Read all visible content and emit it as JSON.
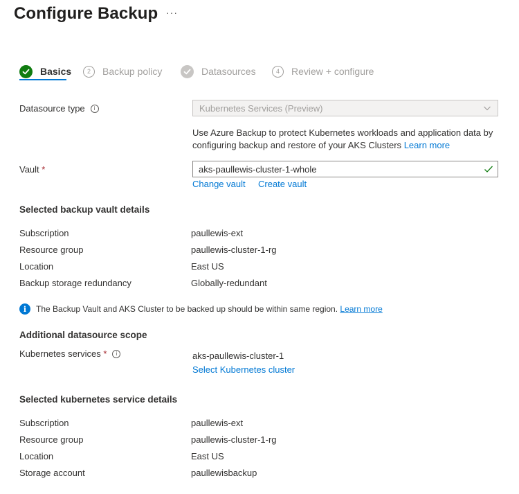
{
  "page": {
    "title": "Configure Backup",
    "more_label": "···"
  },
  "tabs": [
    {
      "label": "Basics",
      "step": "",
      "state": "active"
    },
    {
      "label": "Backup policy",
      "step": "2",
      "state": "pending"
    },
    {
      "label": "Datasources",
      "step": "",
      "state": "done"
    },
    {
      "label": "Review + configure",
      "step": "4",
      "state": "pending"
    }
  ],
  "datasource": {
    "label": "Datasource type",
    "value": "Kubernetes Services (Preview)",
    "description": "Use Azure Backup to protect Kubernetes workloads and application data by configuring backup and restore of your AKS Clusters",
    "learn_more": "Learn more"
  },
  "vault": {
    "label": "Vault",
    "required": "*",
    "value": "aks-paullewis-cluster-1-whole",
    "change_link": "Change vault",
    "create_link": "Create vault"
  },
  "vault_details": {
    "heading": "Selected backup vault details",
    "rows": [
      {
        "label": "Subscription",
        "value": "paullewis-ext"
      },
      {
        "label": "Resource group",
        "value": "paullewis-cluster-1-rg"
      },
      {
        "label": "Location",
        "value": "East US"
      },
      {
        "label": "Backup storage redundancy",
        "value": "Globally-redundant"
      }
    ]
  },
  "notice": {
    "text": "The Backup Vault and AKS Cluster to be backed up should be within same region.",
    "link": "Learn more"
  },
  "scope": {
    "heading": "Additional datasource scope",
    "label": "Kubernetes services",
    "required": "*",
    "value": "aks-paullewis-cluster-1",
    "select_link": "Select Kubernetes cluster"
  },
  "k8s_details": {
    "heading": "Selected kubernetes service details",
    "rows": [
      {
        "label": "Subscription",
        "value": "paullewis-ext"
      },
      {
        "label": "Resource group",
        "value": "paullewis-cluster-1-rg"
      },
      {
        "label": "Location",
        "value": "East US"
      },
      {
        "label": "Storage account",
        "value": "paullewisbackup"
      }
    ]
  },
  "colors": {
    "accent": "#0078d4",
    "success": "#107c10",
    "required": "#a4262c"
  }
}
